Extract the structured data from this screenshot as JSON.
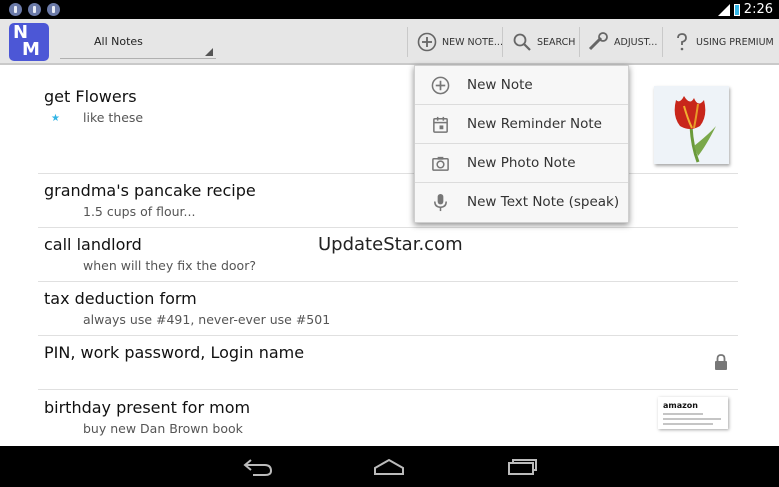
{
  "status_bar": {
    "left_icons": [
      "notification-icon",
      "notification-icon",
      "notification-icon"
    ],
    "time": "2:26"
  },
  "action_bar": {
    "app_logo": "nm-logo",
    "filter_selected": "All Notes",
    "actions": [
      {
        "label": "NEW NOTE...",
        "icon": "plus-circle-icon"
      },
      {
        "label": "SEARCH",
        "icon": "search-icon"
      },
      {
        "label": "ADJUST...",
        "icon": "wrench-icon"
      },
      {
        "label": "USING PREMIUM",
        "icon": "help-icon"
      }
    ]
  },
  "new_note_menu": {
    "items": [
      {
        "label": "New Note",
        "icon": "plus-circle-icon"
      },
      {
        "label": "New Reminder Note",
        "icon": "calendar-icon"
      },
      {
        "label": "New Photo Note",
        "icon": "camera-icon"
      },
      {
        "label": "New Text Note (speak)",
        "icon": "microphone-icon"
      }
    ]
  },
  "notes": [
    {
      "title": "get Flowers",
      "preview": "like these",
      "starred": true,
      "attachment": "tulip-photo"
    },
    {
      "title": "grandma's pancake recipe",
      "preview": "1.5 cups of flour..."
    },
    {
      "title": "call landlord",
      "preview": "when will they fix the door?"
    },
    {
      "title": "tax deduction form",
      "preview": "always use #491, never-ever use #501"
    },
    {
      "title": "PIN, work password, Login name",
      "preview": "",
      "locked": true
    },
    {
      "title": "birthday present for mom",
      "preview": "buy new Dan Brown book",
      "attachment": "amazon-screenshot"
    }
  ],
  "attachment_text": {
    "amazon_word": "amazon"
  },
  "watermark": "UpdateStar.com",
  "nav_bar": {
    "buttons": [
      "back-icon",
      "home-icon",
      "recent-apps-icon"
    ]
  },
  "colors": {
    "accent": "#33b5e5",
    "logo": "#4c57d6",
    "action_bar": "#e6e6e6"
  }
}
